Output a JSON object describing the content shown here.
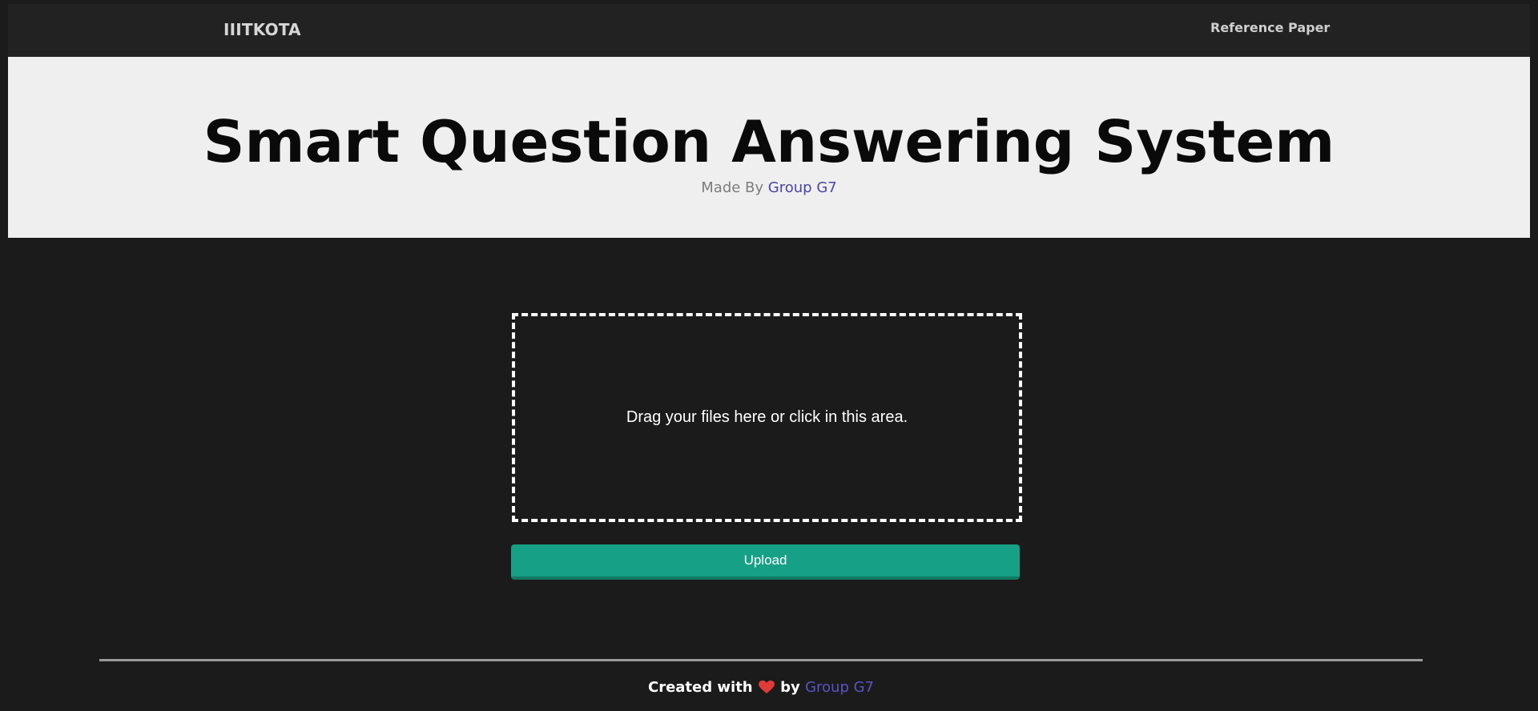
{
  "navbar": {
    "brand": "IIITKOTA",
    "link": "Reference Paper"
  },
  "hero": {
    "title": "Smart Question Answering System",
    "made_by_prefix": "Made By",
    "group": "Group G7"
  },
  "upload": {
    "dropzone_text": "Drag your files here or click in this area.",
    "button_label": "Upload"
  },
  "footer": {
    "prefix": "Created with",
    "by": "by",
    "group": "Group G7"
  },
  "icons": {
    "heart": "heart-icon"
  },
  "colors": {
    "page_background": "#1b1b1b",
    "navbar_background": "#222222",
    "hero_background": "#efefef",
    "accent_button": "#16a085",
    "link_purple": "#4a44a8",
    "heart_red": "#e03a3a"
  }
}
